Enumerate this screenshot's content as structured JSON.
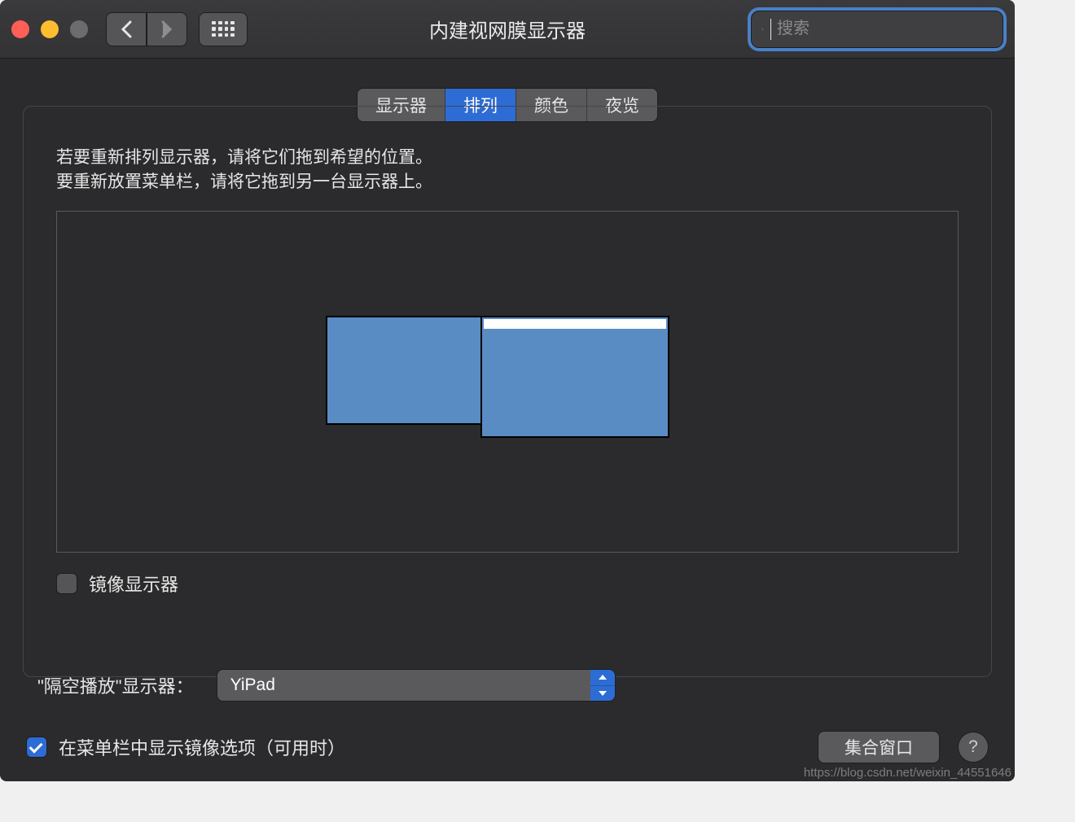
{
  "window": {
    "title": "内建视网膜显示器",
    "search_placeholder": "搜索"
  },
  "tabs": [
    {
      "label": "显示器",
      "active": false
    },
    {
      "label": "排列",
      "active": true
    },
    {
      "label": "颜色",
      "active": false
    },
    {
      "label": "夜览",
      "active": false
    }
  ],
  "instructions": {
    "line1": "若要重新排列显示器，请将它们拖到希望的位置。",
    "line2": "要重新放置菜单栏，请将它拖到另一台显示器上。"
  },
  "mirror": {
    "label": "镜像显示器",
    "checked": false
  },
  "airplay": {
    "label": "\"隔空播放\"显示器：",
    "value": "YiPad"
  },
  "show_mirror_option": {
    "label": "在菜单栏中显示镜像选项（可用时）",
    "checked": true
  },
  "gather_button": "集合窗口",
  "watermark": "https://blog.csdn.net/weixin_44551646"
}
